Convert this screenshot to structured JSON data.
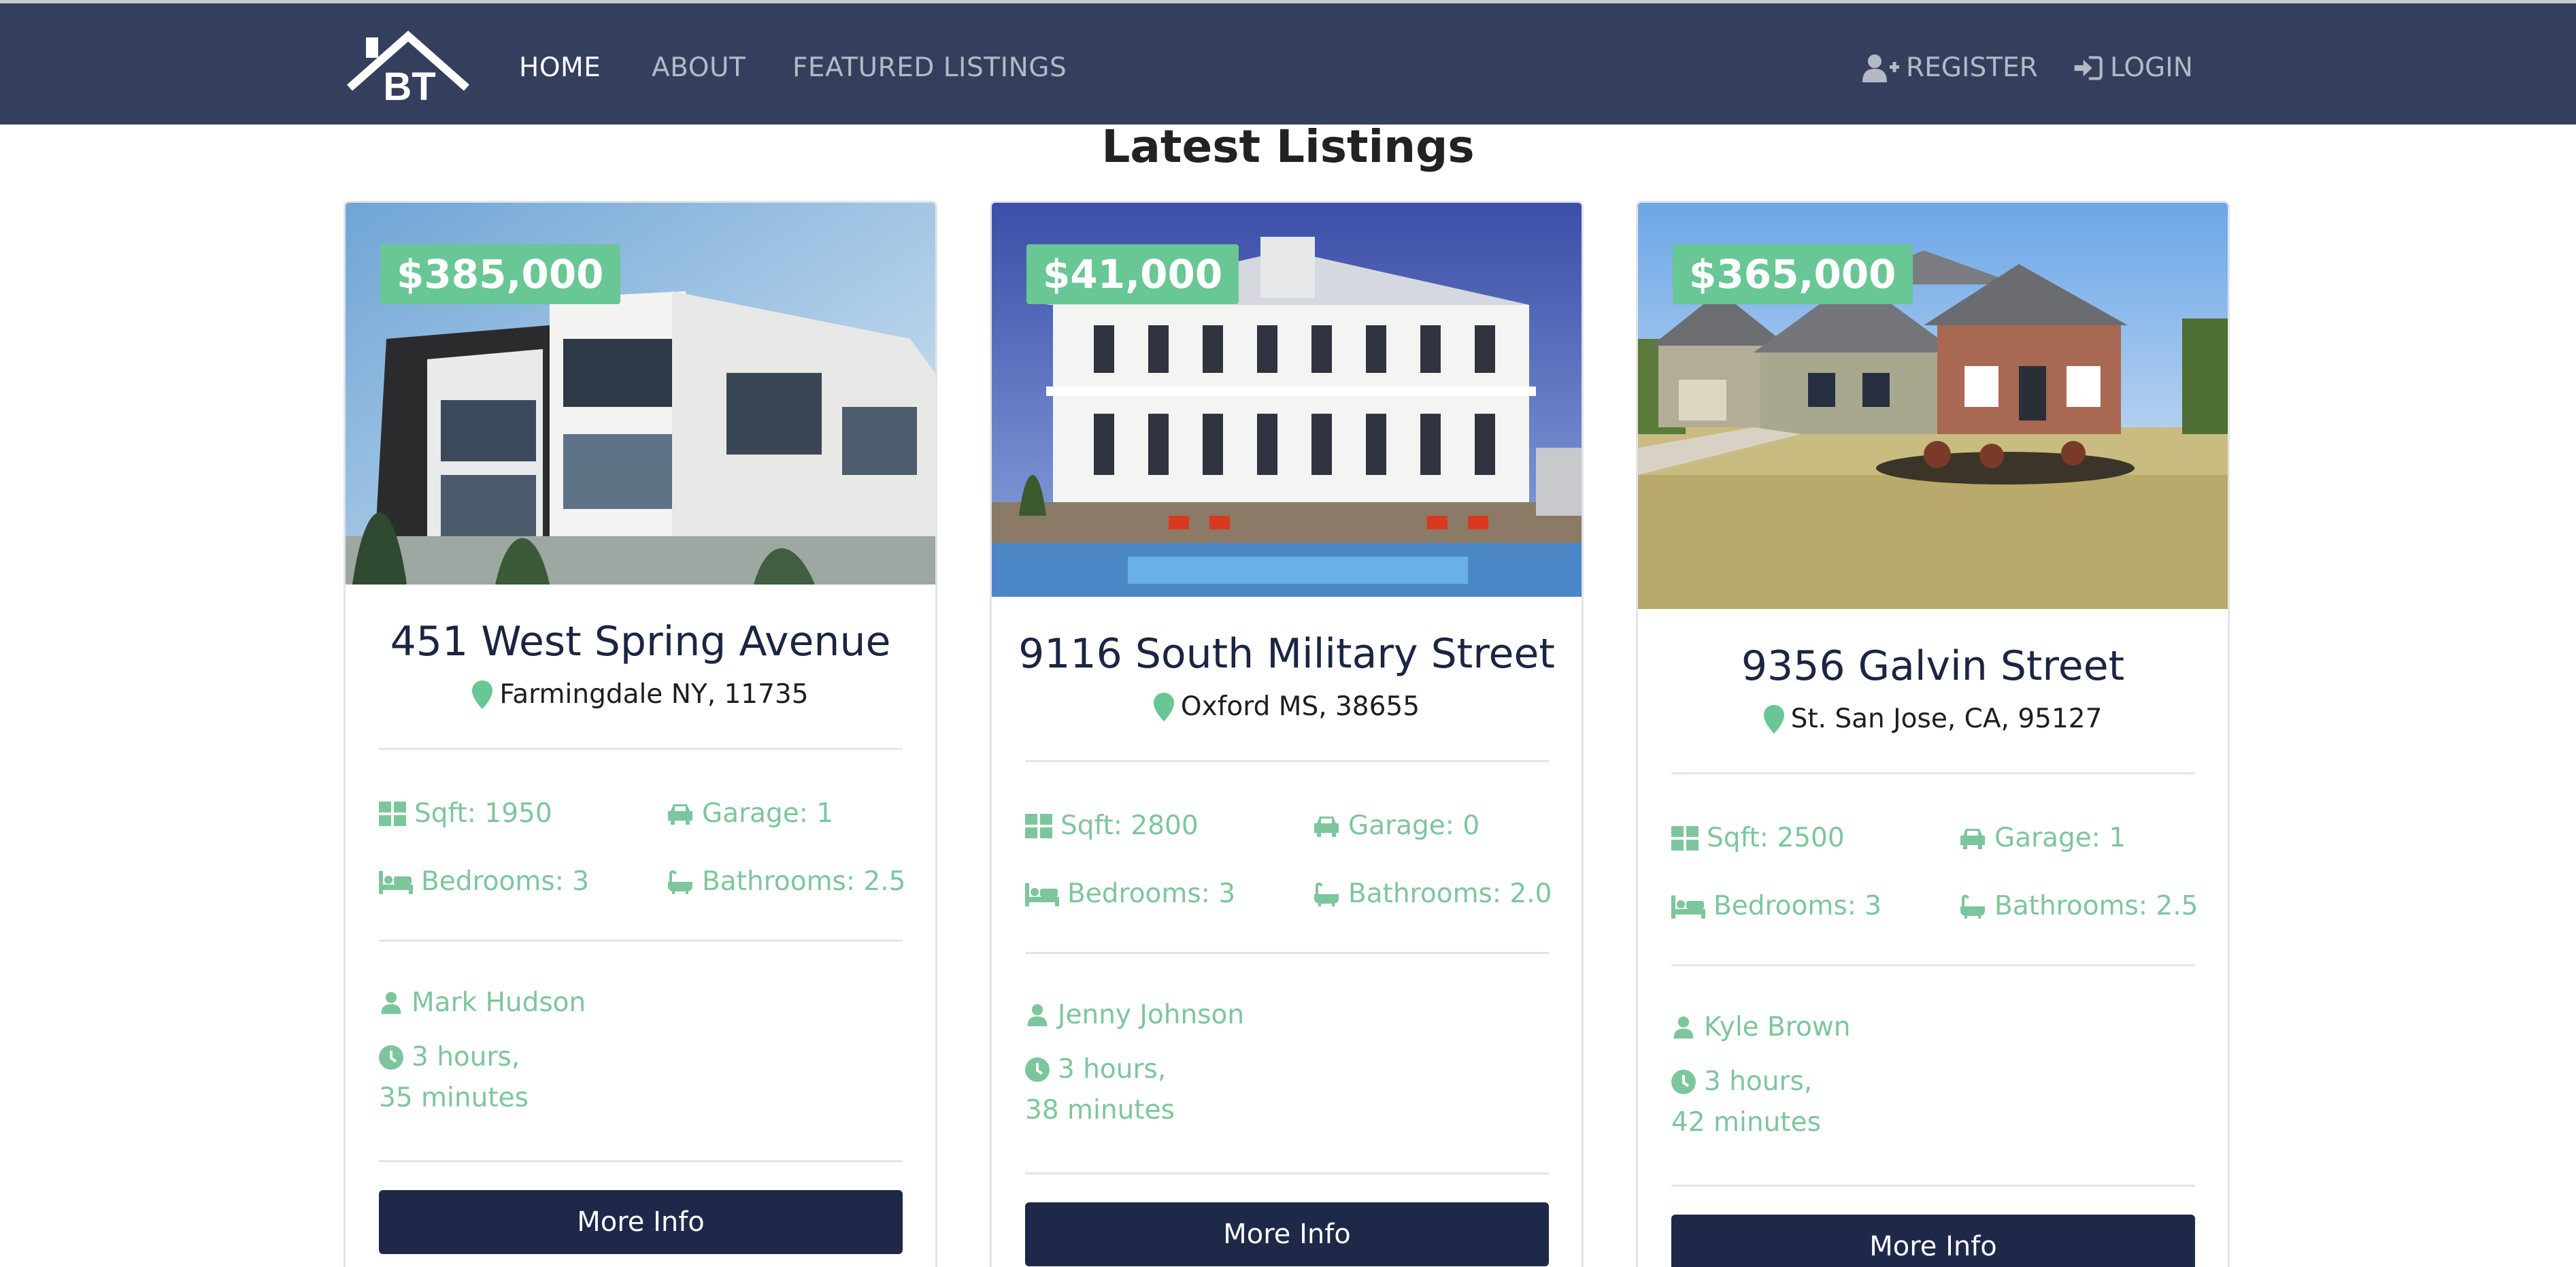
{
  "nav": {
    "logo_text": "BT",
    "links": [
      "HOME",
      "ABOUT",
      "FEATURED LISTINGS"
    ],
    "register": "REGISTER",
    "login": "LOGIN"
  },
  "section_title": "Latest Listings",
  "listings": [
    {
      "price": "$385,000",
      "title": "451 West Spring Avenue",
      "location": "Farmingdale NY, 11735",
      "sqft": "Sqft: 1950",
      "garage": "Garage: 1",
      "bedrooms": "Bedrooms: 3",
      "bathrooms": "Bathrooms: 2.5",
      "agent": "Mark Hudson",
      "time_line1": "3 hours,",
      "time_line2": "35 minutes",
      "button": "More Info"
    },
    {
      "price": "$41,000",
      "title": "9116 South Military Street",
      "location": "Oxford MS, 38655",
      "sqft": "Sqft: 2800",
      "garage": "Garage: 0",
      "bedrooms": "Bedrooms: 3",
      "bathrooms": "Bathrooms: 2.0",
      "agent": "Jenny Johnson",
      "time_line1": "3 hours,",
      "time_line2": "38 minutes",
      "button": "More Info"
    },
    {
      "price": "$365,000",
      "title": "9356 Galvin Street",
      "location": "St. San Jose, CA, 95127",
      "sqft": "Sqft: 2500",
      "garage": "Garage: 1",
      "bedrooms": "Bedrooms: 3",
      "bathrooms": "Bathrooms: 2.5",
      "agent": "Kyle Brown",
      "time_line1": "3 hours,",
      "time_line2": "42 minutes",
      "button": "More Info"
    }
  ],
  "colors": {
    "navbar": "#343f5e",
    "accent": "#69c695",
    "feature_text": "#7dc69c",
    "button": "#1e2849"
  },
  "icons": [
    "house-logo",
    "user-plus-icon",
    "sign-in-icon",
    "map-marker-icon",
    "grid-icon",
    "car-icon",
    "bed-icon",
    "bath-icon",
    "user-icon",
    "clock-icon"
  ]
}
